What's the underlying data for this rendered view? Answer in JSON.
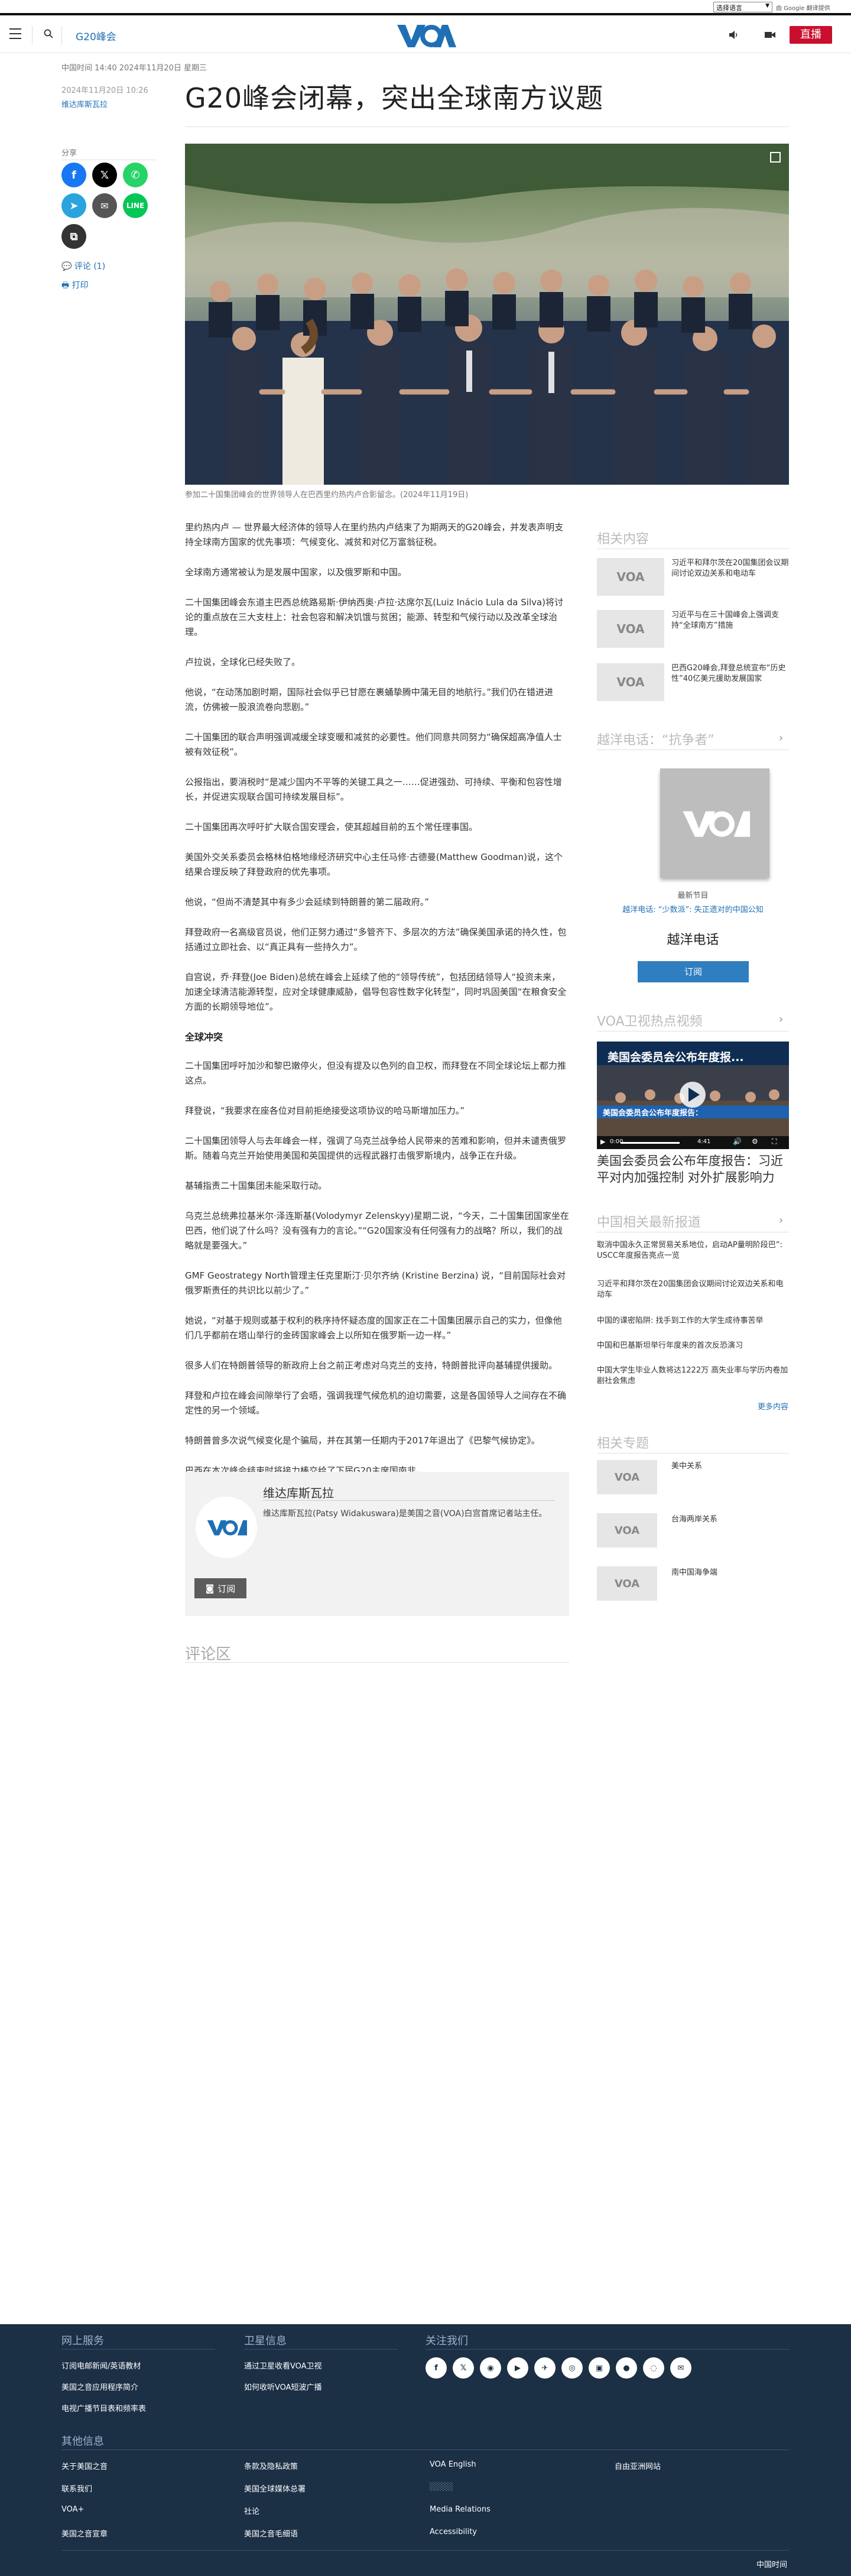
{
  "topbar": {
    "language_select": "选择语言",
    "translate_label": "由 Google 翻译提供"
  },
  "header": {
    "section": "G20峰会",
    "live_label": "直播"
  },
  "article": {
    "dateline": "中国时间 14:40 2024年11月20日 星期三",
    "published": "2024年11月20日 10:26",
    "author": "维达库斯瓦拉",
    "title": "G20峰会闭幕，突出全球南方议题",
    "share_label": "分享",
    "comment_label": "评论 (1)",
    "print_label": "打印",
    "caption": "参加二十国集团峰会的世界领导人在巴西里约热内卢合影留念。(2024年11月19日)",
    "paragraphs": [
      "里约热内卢 — 世界最大经济体的领导人在里约热内卢结束了为期两天的G20峰会，并发表声明支持全球南方国家的优先事项：气候变化、减贫和对亿万富翁征税。",
      "全球南方通常被认为是发展中国家，以及俄罗斯和中国。",
      "二十国集团峰会东道主巴西总统路易斯·伊纳西奥·卢拉·达席尔瓦(Luiz Inácio Lula da Silva)将讨论的重点放在三大支柱上：社会包容和解决饥饿与贫困；能源、转型和气候行动以及改革全球治理。",
      "卢拉说，全球化已经失败了。",
      "他说，“在动荡加剧时期，国际社会似乎已甘愿在裹蛹挚腾中蒲无目的地航行。”我们仍在错进进流，仿佛被一股浪流卷向悲剧。”",
      "二十国集团的联合声明强调减缓全球变暖和减贫的必要性。他们同意共同努力“确保超高净值人士被有效征税”。",
      "公报指出，要消税时“是减少国内不平等的关键工具之一……促进强劲、可持续、平衡和包容性增长，并促进实现联合国可持续发展目标”。",
      "二十国集团再次呼吁扩大联合国安理会，使其超越目前的五个常任理事国。",
      "美国外交关系委员会格林伯格地缘经济研究中心主任马修·古德曼(Matthew Goodman)说，这个结果合理反映了拜登政府的优先事项。",
      "他说，“但尚不清楚其中有多少会延续到特朗普的第二届政府。”",
      "拜登政府一名高级官员说，他们正努力通过“多管齐下、多层次的方法”确保美国承诺的持久性，包括通过立即社会、以“真正具有一些持久力”。",
      "自宫说，乔·拜登(Joe Biden)总统在峰会上延续了他的“领导传统”，包括团结领导人“投资未来，加速全球清洁能源转型，应对全球健康威胁，倡导包容性数字化转型”，同时巩固美国“在粮食安全方面的长期领导地位”。"
    ],
    "section_heading": "全球冲突",
    "paragraphs_2": [
      "二十国集团呼吁加沙和黎巴嫩停火，但没有提及以色列的自卫权，而拜登在不同全球论坛上都力推这点。",
      "拜登说，“我要求在座各位对目前拒绝接受这项协议的哈马斯增加压力。”",
      "二十国集团领导人与去年峰会一样，强调了乌克兰战争给人民带来的苦难和影响，但并未谴责俄罗斯。随着乌克兰开始使用美国和英国提供的远程武器打击俄罗斯境内，战争正在升级。",
      "基辅指责二十国集团未能采取行动。",
      "乌克兰总统弗拉基米尔·泽连斯基(Volodymyr Zelenskyy)星期二说，“今天，二十国集团国家坐在巴西，他们说了什么吗？没有强有力的言论。”“G20国家没有任何强有力的战略？所以，我们的战略就是要强大。”",
      "GMF Geostrategy North管理主任克里斯汀·贝尔齐纳 (Kristine Berzina) 说，“目前国际社会对俄罗斯责任的共识比以前少了。”",
      "她说，“对基于规则或基于权利的秩序持怀疑态度的国家正在二十国集团展示自己的实力，但像他们几乎都前在塔山举行的金砖国家峰会上以所知在俄罗斯一边一样。”",
      "很多人们在特朗普领导的新政府上台之前正考虑对乌克兰的支持，特朗普批评向基辅提供援助。",
      "拜登和卢拉在峰会间隙举行了会晤，强调我理气候危机的迫切需要，这是各国领导人之间存在不确定性的另一个领域。",
      "特朗普曾多次说气候变化是个骗局，并在其第一任期内于2017年退出了《巴黎气候协定》。",
      "巴西在本次峰会结束时将接力棒交给了下届G20主席国南非。"
    ],
    "author_box": {
      "name": "维达库斯瓦拉",
      "bio": "维达库斯瓦拉(Patsy Widakuswara)是美国之音(VOA)白宫首席记者站主任。",
      "subscribe": "订阅"
    },
    "comments_title": "评论区"
  },
  "sidebar": {
    "related_title": "相关内容",
    "related": [
      "习近平和拜尔茨在20国集团会议期间讨论双边关系和电动车",
      "习近平与在三十国峰会上强调支持“全球南方”措施",
      "巴西G20峰会,拜登总统宣布“历史性”40亿美元援助发展国家"
    ],
    "radio_title": "越洋电话：“抗争者”",
    "radio_label": "最新节目",
    "radio_episode": "越洋电话: “少数派”: 失正遗对的中国公知",
    "radio_name": "越洋电话",
    "radio_subscribe": "订阅",
    "video_title": "VOA卫视热点视频",
    "video_overlay": "美国会委员会公布年度报...",
    "video_subtitle": "美国会委员会公布年度报告：",
    "video_time": "0:00",
    "video_duration": "4:41",
    "video_headline": "美国会委员会公布年度报告：习近平对内加强控制 对外扩展影响力",
    "china_title": "中国相关最新报道",
    "china_news": [
      "取消中国永久正常贸易关系地位，启动AP量明阶段巴”: USCC年度报告亮点一览",
      "习近平和拜尔茨在20国集团会议期间讨论双边关系和电动车",
      "中国的课密陷阱: 找手到工作的大学生成待事苦举",
      "中国和巴基斯坦举行年度来的首次反恐演习",
      "中国大学生毕业人数将达1222万 高失业率与学历内卷加剧社会焦虑"
    ],
    "more_label": "更多内容",
    "topics_title": "相关专题",
    "topics": [
      "美中关系",
      "台海两岸关系",
      "南中国海争端"
    ]
  },
  "footer": {
    "services_title": "网上服务",
    "services": [
      "订阅电邮新闻/英语教材",
      "美国之音应用程序简介",
      "电视广播节目表和频率表"
    ],
    "satellite_title": "卫星信息",
    "satellite": [
      "通过卫星收看VOA卫视",
      "如何收听VOA短波广播"
    ],
    "follow_title": "关注我们",
    "social": [
      "f",
      "𝕏",
      "◉",
      "▶",
      "✈",
      "◎",
      "▣",
      "●",
      "◌",
      "✉"
    ],
    "other_title": "其他信息",
    "other_col1": [
      "关于美国之音",
      "联系我们",
      "VOA+",
      "美国之音宣章"
    ],
    "other_col2": [
      "条款及隐私政策",
      "美国全球媒体总署",
      "社论",
      "美国之音毛细语"
    ],
    "other_col3": [
      "VOA English",
      "░░░░",
      "Media Relations",
      "Accessibility"
    ],
    "other_col4": [
      "自由亚洲网站"
    ],
    "bottom_time": "中国时间"
  }
}
